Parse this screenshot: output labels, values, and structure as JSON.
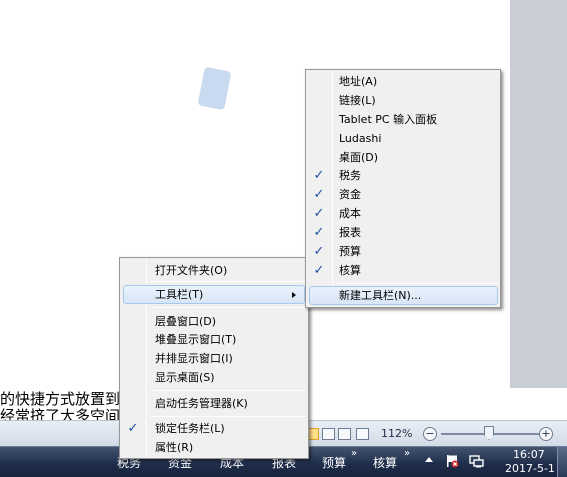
{
  "document": {
    "text_lines": [
      "的快捷方式放置到",
      "经常挤了大多空间"
    ]
  },
  "statusbar": {
    "zoom_level": "112%",
    "zoom_minus": "−",
    "zoom_plus": "+"
  },
  "taskbar": {
    "items": [
      {
        "label": "税务"
      },
      {
        "label": "资金"
      },
      {
        "label": "成本"
      },
      {
        "label": "报表"
      },
      {
        "label": "预算"
      },
      {
        "label": "核算"
      }
    ],
    "chevron": "»",
    "clock": {
      "time": "16:07",
      "date": "2017-5-1"
    }
  },
  "main_menu": {
    "items": [
      {
        "label": "打开文件夹(O)"
      },
      {
        "label": "工具栏(T)",
        "highlighted": true,
        "has_submenu": true
      },
      {
        "label": "层叠窗口(D)"
      },
      {
        "label": "堆叠显示窗口(T)"
      },
      {
        "label": "并排显示窗口(I)"
      },
      {
        "label": "显示桌面(S)"
      },
      {
        "label": "启动任务管理器(K)"
      },
      {
        "label": "锁定任务栏(L)",
        "checked": true
      },
      {
        "label": "属性(R)"
      }
    ]
  },
  "toolbar_submenu": {
    "items": [
      {
        "label": "地址(A)",
        "checked": false
      },
      {
        "label": "链接(L)",
        "checked": false
      },
      {
        "label": "Tablet PC 输入面板",
        "checked": false
      },
      {
        "label": "Ludashi",
        "checked": false
      },
      {
        "label": "桌面(D)",
        "checked": false
      },
      {
        "label": "税务",
        "checked": true
      },
      {
        "label": "资金",
        "checked": true
      },
      {
        "label": "成本",
        "checked": true
      },
      {
        "label": "报表",
        "checked": true
      },
      {
        "label": "预算",
        "checked": true
      },
      {
        "label": "核算",
        "checked": true
      }
    ],
    "new_toolbar": "新建工具栏(N)..."
  },
  "icons": {
    "check": "✓",
    "submenu_arrow": "chevron-right-icon"
  }
}
